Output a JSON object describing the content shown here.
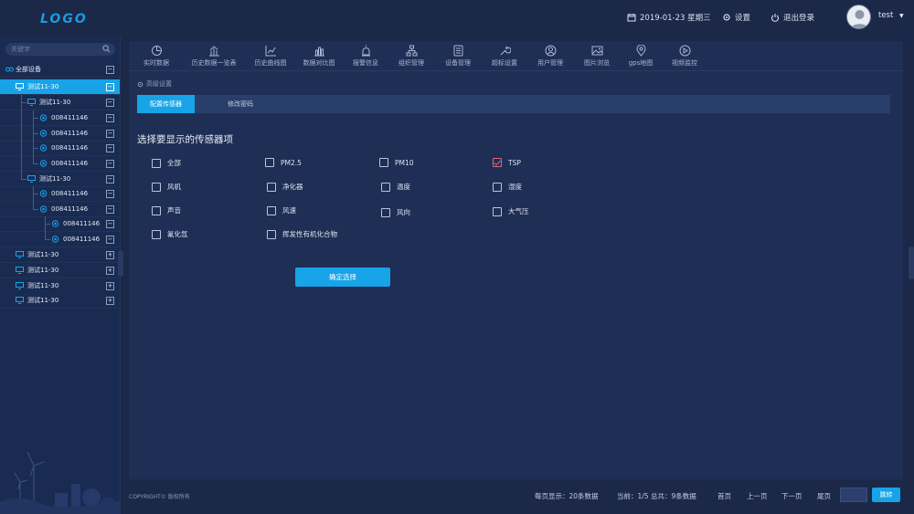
{
  "header": {
    "logo": "LOGO",
    "date": "2019-01-23 星期三",
    "settings": "设置",
    "logout": "退出登录",
    "user": "test"
  },
  "sidebar": {
    "search_placeholder": "关键字",
    "root": "全部设备",
    "group_label": "测试11-30",
    "device_label": "008411146",
    "collapse_symbol": "−",
    "expand_symbol": "+"
  },
  "nav": {
    "items": [
      "实时数据",
      "历史数据一览表",
      "历史曲线图",
      "数据对比图",
      "报警信息",
      "组织管理",
      "设备管理",
      "超标设置",
      "用户管理",
      "图片浏览",
      "gps地图",
      "视频监控"
    ]
  },
  "breadcrumb": "高级设置",
  "tabs": [
    "配置传感器",
    "修改密码"
  ],
  "section_title": "选择要显示的传感器项",
  "options": [
    {
      "label": "全部",
      "checked": false
    },
    {
      "label": "PM2.5",
      "checked": false
    },
    {
      "label": "PM10",
      "checked": false
    },
    {
      "label": "TSP",
      "checked": true
    },
    {
      "label": "风机",
      "checked": false
    },
    {
      "label": "净化器",
      "checked": false
    },
    {
      "label": "温度",
      "checked": false
    },
    {
      "label": "湿度",
      "checked": false
    },
    {
      "label": "声音",
      "checked": false
    },
    {
      "label": "风速",
      "checked": false
    },
    {
      "label": "风向",
      "checked": false
    },
    {
      "label": "大气压",
      "checked": false
    },
    {
      "label": "氟化氙",
      "checked": false
    },
    {
      "label": "挥发性有机化合物",
      "checked": false
    }
  ],
  "confirm": "确定选择",
  "footer": {
    "copyright": "COPYRIGHT© 版权所有",
    "per_page": "每页显示：20条数据",
    "current": "当前：1/5  总共：9条数据",
    "first": "首页",
    "prev": "上一页",
    "next": "下一页",
    "last": "尾页",
    "go": "跳转"
  },
  "colors": {
    "accent": "#17a3e8",
    "bg": "#1b2847",
    "panel": "#1f2e54"
  }
}
